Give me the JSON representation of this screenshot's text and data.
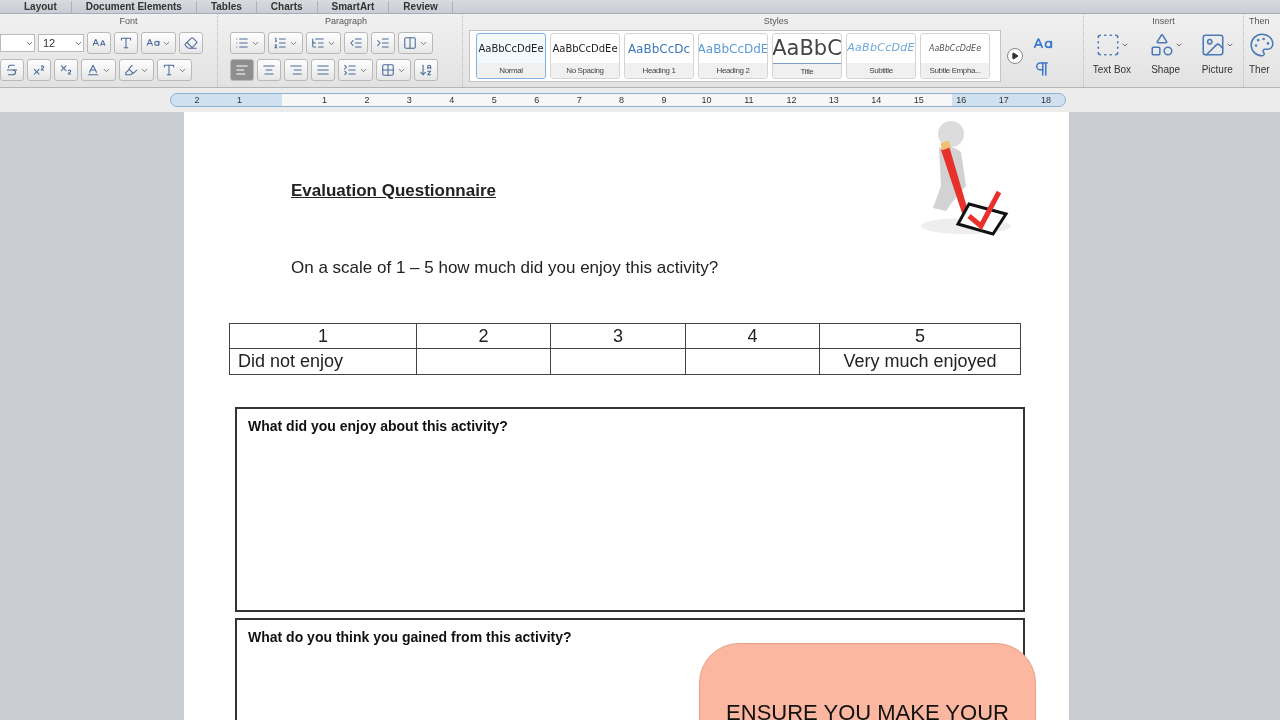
{
  "tabs": [
    "Layout",
    "Document Elements",
    "Tables",
    "Charts",
    "SmartArt",
    "Review"
  ],
  "ribbon": {
    "font": {
      "title": "Font",
      "size": "12"
    },
    "paragraph": {
      "title": "Paragraph",
      "alignments": [
        {
          "kind": "left",
          "selected": true
        },
        {
          "kind": "center",
          "selected": false
        },
        {
          "kind": "right",
          "selected": false
        },
        {
          "kind": "justify",
          "selected": false
        }
      ]
    },
    "styles": {
      "title": "Styles",
      "items": [
        {
          "kind": "normal",
          "preview": "AaBbCcDdEe",
          "name": "Normal",
          "selected": true
        },
        {
          "kind": "normal",
          "preview": "AaBbCcDdEe",
          "name": "No Spacing",
          "selected": false
        },
        {
          "kind": "heading1",
          "preview": "AaBbCcDc",
          "name": "Heading 1",
          "selected": false
        },
        {
          "kind": "heading2",
          "preview": "AaBbCcDdE",
          "name": "Heading 2",
          "selected": false
        },
        {
          "kind": "title",
          "preview": "AaBbC",
          "name": "Title",
          "selected": false
        },
        {
          "kind": "subtitle",
          "preview": "AaBbCcDdE",
          "name": "Subtitle",
          "selected": false
        },
        {
          "kind": "emphasis",
          "preview": "AaBbCcDdEe",
          "name": "Subtle Empha...",
          "selected": false
        }
      ]
    },
    "insert": {
      "title": "Insert",
      "items": [
        {
          "kind": "textbox",
          "label": "Text Box"
        },
        {
          "kind": "shape",
          "label": "Shape"
        },
        {
          "kind": "picture",
          "label": "Picture"
        }
      ]
    },
    "themes": {
      "title": "Then",
      "button": "Ther"
    }
  },
  "ruler": [
    "2",
    "1",
    "1",
    "2",
    "3",
    "4",
    "5",
    "6",
    "7",
    "8",
    "9",
    "10",
    "11",
    "12",
    "13",
    "14",
    "15",
    "16",
    "17",
    "18"
  ],
  "document": {
    "title": "Evaluation Questionnaire",
    "question": "On a scale of 1 – 5 how much did you enjoy this activity?",
    "scale_table": {
      "header": [
        "1",
        "2",
        "3",
        "4",
        "5"
      ],
      "low_label": "Did not enjoy",
      "high_label": "Very much enjoyed"
    },
    "boxes": [
      {
        "prompt": "What did you enjoy about this activity?"
      },
      {
        "prompt": "What do you think you gained from this activity?"
      }
    ],
    "callout": {
      "text": "ENSURE YOU MAKE YOUR"
    }
  }
}
